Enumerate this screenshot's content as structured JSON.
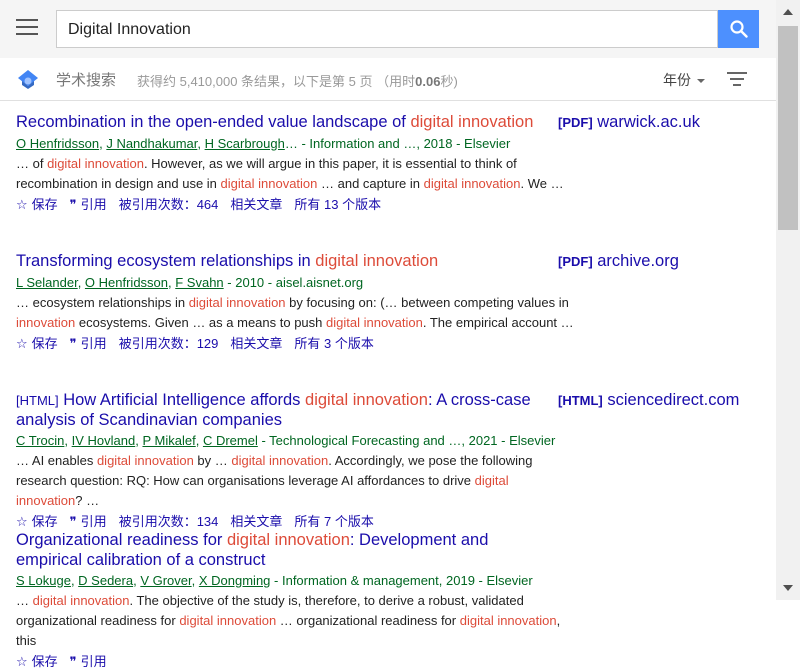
{
  "search": {
    "query": "Digital Innovation"
  },
  "subbar": {
    "brand": "学术搜索",
    "stats_prefix": "获得约 5,410,000 条结果，以下是第 5 页 （用时",
    "stats_time": "0.06",
    "stats_suffix": "秒)",
    "year_label": "年份"
  },
  "colors": {
    "link": "#1a0dab",
    "highlight": "#dd4b39",
    "author": "#006621",
    "search_button": "#4d90fe"
  },
  "icons": {
    "menu": "hamburger-icon",
    "search": "magnifier-icon",
    "logo": "scholar-cap-icon",
    "filter": "filter-lines-icon",
    "star": "star-icon",
    "cite": "quote-icon"
  },
  "results": [
    {
      "kind": "",
      "title_parts": [
        [
          "Recombination in the open-ended value landscape of ",
          false
        ],
        [
          "digital innovation",
          true
        ]
      ],
      "side_format": "[PDF]",
      "side_domain": "warwick.ac.uk",
      "authors": [
        "O Henfridsson",
        "J Nandhakumar",
        "H Scarbrough"
      ],
      "author_seps": [
        ", ",
        ", ",
        "… "
      ],
      "venue": "- Information and …, 2018 - Elsevier",
      "snippet": [
        [
          [
            "… of ",
            false
          ],
          [
            "digital innovation",
            true
          ],
          [
            ". However, as we will argue in this paper, it is essential to think of",
            false
          ]
        ],
        [
          [
            "recombination in design and use in ",
            false
          ],
          [
            "digital innovation",
            true
          ],
          [
            " … and capture in ",
            false
          ],
          [
            "digital innovation",
            true
          ],
          [
            ". We …",
            false
          ]
        ]
      ],
      "actions": {
        "save": "保存",
        "cite": "引用",
        "cited_by": "被引用次数：464",
        "related": "相关文章",
        "versions": "所有 13 个版本"
      }
    },
    {
      "kind": "",
      "title_parts": [
        [
          "Transforming ecosystem relationships in ",
          false
        ],
        [
          "digital innovation",
          true
        ]
      ],
      "side_format": "[PDF]",
      "side_domain": "archive.org",
      "authors": [
        "L Selander",
        "O Henfridsson",
        "F Svahn"
      ],
      "author_seps": [
        ", ",
        ", ",
        " "
      ],
      "venue": "- 2010 - aisel.aisnet.org",
      "snippet": [
        [
          [
            "… ecosystem relationships in ",
            false
          ],
          [
            "digital innovation",
            true
          ],
          [
            " by focusing on: (… between competing values in",
            false
          ]
        ],
        [
          [
            "innovation",
            true
          ],
          [
            " ecosystems. Given … as a means to push ",
            false
          ],
          [
            "digital innovation",
            true
          ],
          [
            ". The empirical account …",
            false
          ]
        ]
      ],
      "actions": {
        "save": "保存",
        "cite": "引用",
        "cited_by": "被引用次数：129",
        "related": "相关文章",
        "versions": "所有 3 个版本"
      }
    },
    {
      "kind": "[HTML]",
      "title_parts": [
        [
          " How Artificial Intelligence affords ",
          false
        ],
        [
          "digital innovation",
          true
        ],
        [
          ": A cross-case analysis of Scandinavian companies",
          false
        ]
      ],
      "side_format": "[HTML]",
      "side_domain": "sciencedirect.com",
      "authors": [
        "C Trocin",
        "IV Hovland",
        "P Mikalef",
        "C Dremel"
      ],
      "author_seps": [
        ", ",
        ", ",
        ", ",
        " "
      ],
      "venue": "- Technological Forecasting and …, 2021 - Elsevier",
      "snippet": [
        [
          [
            "… AI enables ",
            false
          ],
          [
            "digital innovation",
            true
          ],
          [
            " by … ",
            false
          ],
          [
            "digital innovation",
            true
          ],
          [
            ". Accordingly, we pose the following",
            false
          ]
        ],
        [
          [
            "research question: RQ: How can organisations leverage AI affordances to drive ",
            false
          ],
          [
            "digital innovation",
            true
          ],
          [
            "? …",
            false
          ]
        ]
      ],
      "actions": {
        "save": "保存",
        "cite": "引用",
        "cited_by": "被引用次数：134",
        "related": "相关文章",
        "versions": "所有 7 个版本"
      }
    },
    {
      "kind": "",
      "title_parts": [
        [
          "Organizational readiness for ",
          false
        ],
        [
          "digital innovation",
          true
        ],
        [
          ": Development and empirical calibration of a construct",
          false
        ]
      ],
      "side_format": "",
      "side_domain": "",
      "authors": [
        "S Lokuge",
        "D Sedera",
        "V Grover",
        "X Dongming"
      ],
      "author_seps": [
        ", ",
        ", ",
        ", ",
        " "
      ],
      "venue": "- Information & management, 2019 - Elsevier",
      "snippet": [
        [
          [
            "… ",
            false
          ],
          [
            "digital innovation",
            true
          ],
          [
            ". The objective of the study is, therefore, to derive a robust, validated",
            false
          ]
        ],
        [
          [
            "organizational readiness for ",
            false
          ],
          [
            "digital innovation",
            true
          ],
          [
            " … organizational readiness for ",
            false
          ],
          [
            "digital innovation",
            true
          ],
          [
            ", this",
            false
          ]
        ]
      ],
      "actions": {
        "save": "保存",
        "cite": "引用",
        "cited_by": "",
        "related": "",
        "versions": ""
      }
    }
  ]
}
